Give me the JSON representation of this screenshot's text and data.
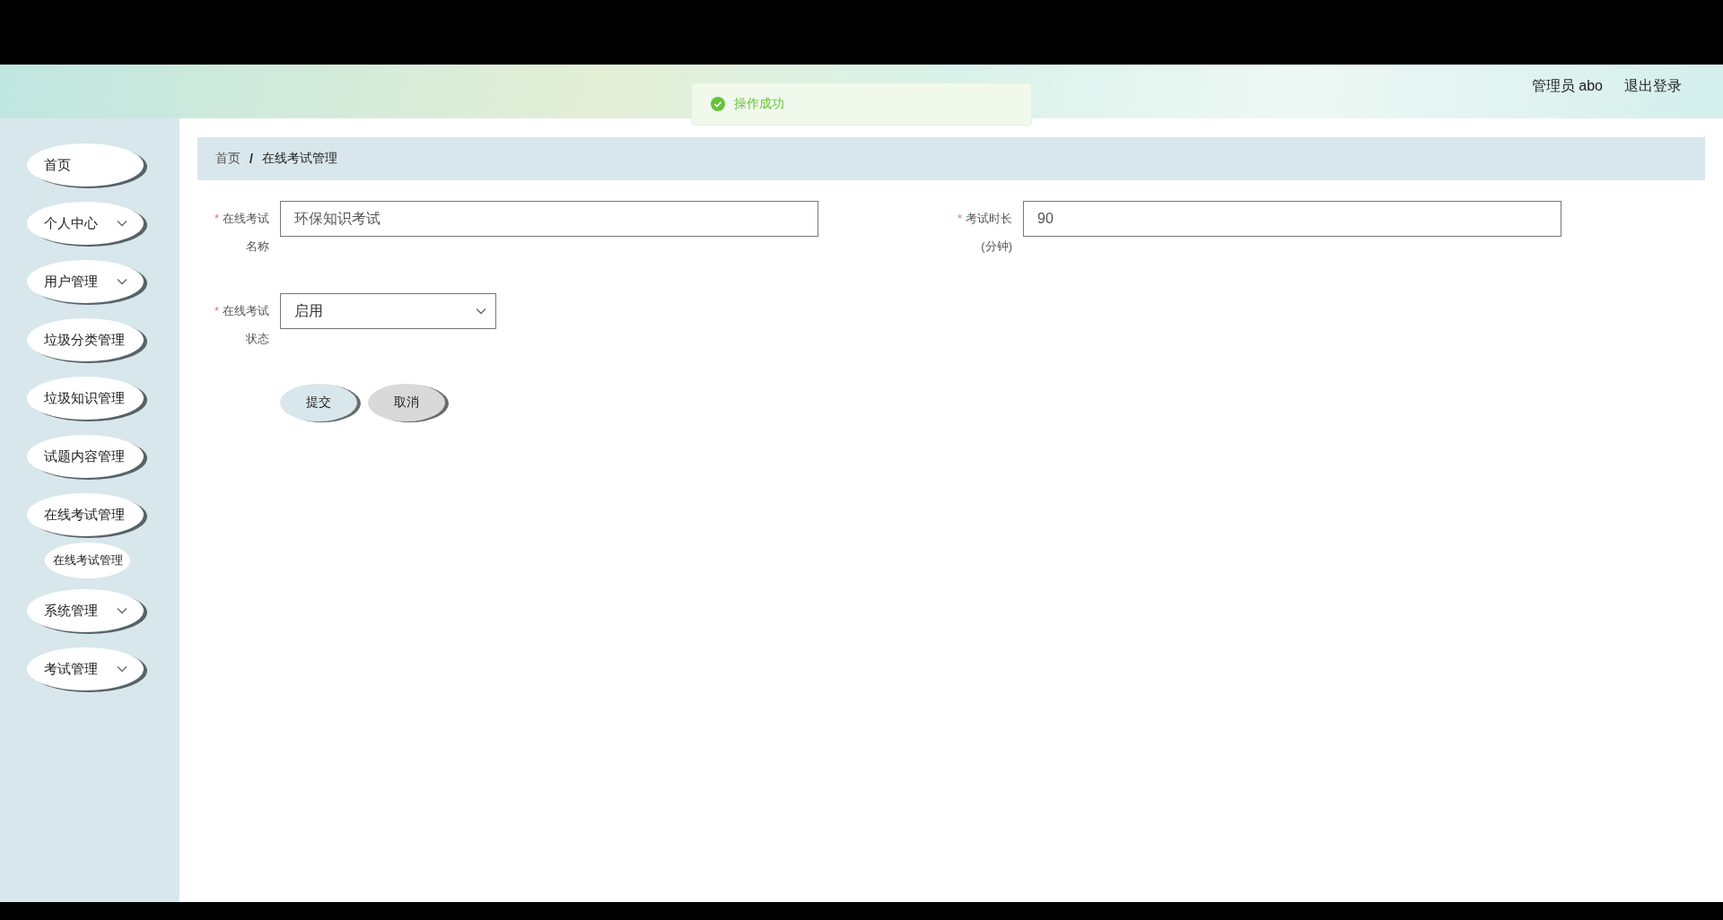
{
  "toast": {
    "kind": "success",
    "message": "操作成功"
  },
  "header": {
    "user": "管理员 abo",
    "logout": "退出登录"
  },
  "sidebar": {
    "items": [
      {
        "label": "首页",
        "expandable": false
      },
      {
        "label": "个人中心",
        "expandable": true
      },
      {
        "label": "用户管理",
        "expandable": true
      },
      {
        "label": "垃圾分类管理",
        "expandable": false
      },
      {
        "label": "垃圾知识管理",
        "expandable": false
      },
      {
        "label": "试题内容管理",
        "expandable": false
      },
      {
        "label": "在线考试管理",
        "expandable": false,
        "children": [
          {
            "label": "在线考试管理"
          }
        ]
      },
      {
        "label": "系统管理",
        "expandable": true
      },
      {
        "label": "考试管理",
        "expandable": true
      }
    ]
  },
  "breadcrumb": {
    "separator": "/",
    "items": [
      "首页",
      "在线考试管理"
    ]
  },
  "form": {
    "rows": [
      [
        {
          "kind": "input",
          "required_mark": "*",
          "label": "在线考试",
          "label_2": "名称",
          "value": "环保知识考试"
        },
        {
          "kind": "input",
          "required_mark": "*",
          "label": "考试时长",
          "label_2": "(分钟)",
          "value": "90"
        }
      ],
      [
        {
          "kind": "select",
          "required_mark": "*",
          "label": "在线考试",
          "label_2": "状态",
          "value": "启用"
        }
      ]
    ],
    "buttons": [
      {
        "label": "提交",
        "kind": "primary"
      },
      {
        "label": "取消",
        "kind": "default"
      }
    ]
  }
}
